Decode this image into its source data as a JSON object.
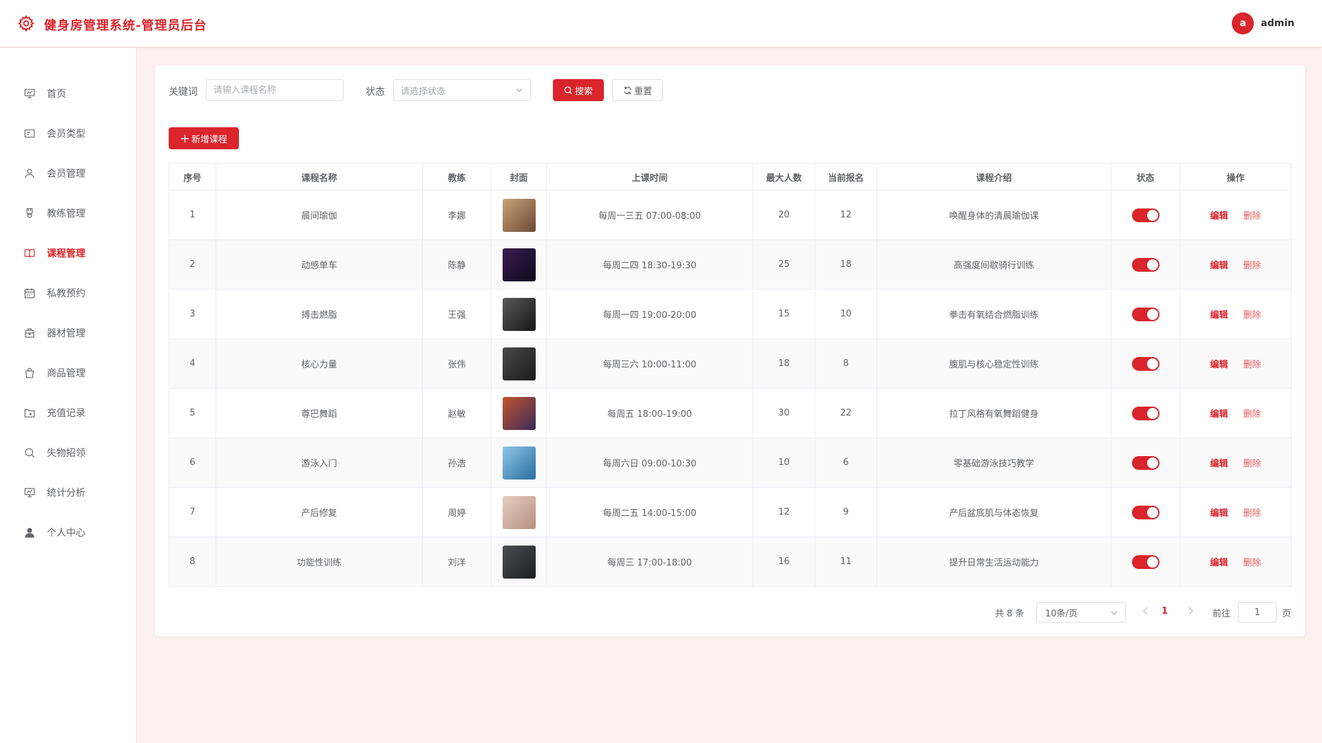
{
  "app": {
    "title": "健身房管理系统-管理员后台",
    "user_initial": "a",
    "username": "admin"
  },
  "sidebar": {
    "items": [
      {
        "label": "首页",
        "icon": "dashboard-icon"
      },
      {
        "label": "会员类型",
        "icon": "card-icon"
      },
      {
        "label": "会员管理",
        "icon": "user-icon"
      },
      {
        "label": "教练管理",
        "icon": "medal-icon"
      },
      {
        "label": "课程管理",
        "icon": "book-icon",
        "active": true
      },
      {
        "label": "私教预约",
        "icon": "calendar-icon"
      },
      {
        "label": "器材管理",
        "icon": "box-icon"
      },
      {
        "label": "商品管理",
        "icon": "bag-icon"
      },
      {
        "label": "充值记录",
        "icon": "folder-icon"
      },
      {
        "label": "失物招领",
        "icon": "search-icon"
      },
      {
        "label": "统计分析",
        "icon": "chart-icon"
      },
      {
        "label": "个人中心",
        "icon": "person-icon"
      }
    ]
  },
  "filters": {
    "keyword_label": "关键词",
    "keyword_placeholder": "请输入课程名称",
    "status_label": "状态",
    "status_placeholder": "请选择状态",
    "search_label": "搜索",
    "reset_label": "重置"
  },
  "add_button": "新增课程",
  "table": {
    "headers": [
      "序号",
      "课程名称",
      "教练",
      "封面",
      "上课时间",
      "最大人数",
      "当前报名",
      "课程介绍",
      "状态",
      "操作"
    ],
    "edit_label": "编辑",
    "delete_label": "删除",
    "rows": [
      {
        "no": "1",
        "name": "晨间瑜伽",
        "coach": "李娜",
        "time": "每周一三五 07:00-08:00",
        "max": "20",
        "current": "12",
        "desc": "唤醒身体的清晨瑜伽课",
        "enabled": true,
        "cover": [
          "#c9a27a",
          "#6b4a33"
        ]
      },
      {
        "no": "2",
        "name": "动感单车",
        "coach": "陈静",
        "time": "每周二四 18:30-19:30",
        "max": "25",
        "current": "18",
        "desc": "高强度间歇骑行训练",
        "enabled": true,
        "cover": [
          "#3a1d4f",
          "#0d0a1c"
        ]
      },
      {
        "no": "3",
        "name": "搏击燃脂",
        "coach": "王强",
        "time": "每周一四 19:00-20:00",
        "max": "15",
        "current": "10",
        "desc": "拳击有氧结合燃脂训练",
        "enabled": true,
        "cover": [
          "#5a5a5a",
          "#151515"
        ]
      },
      {
        "no": "4",
        "name": "核心力量",
        "coach": "张伟",
        "time": "每周三六 10:00-11:00",
        "max": "18",
        "current": "8",
        "desc": "腹肌与核心稳定性训练",
        "enabled": true,
        "cover": [
          "#4a4a4a",
          "#1a1a1a"
        ]
      },
      {
        "no": "5",
        "name": "尊巴舞蹈",
        "coach": "赵敏",
        "time": "每周五 18:00-19:00",
        "max": "30",
        "current": "22",
        "desc": "拉丁风格有氧舞蹈健身",
        "enabled": true,
        "cover": [
          "#c2552e",
          "#3a2a5a"
        ]
      },
      {
        "no": "6",
        "name": "游泳入门",
        "coach": "孙浩",
        "time": "每周六日 09:00-10:30",
        "max": "10",
        "current": "6",
        "desc": "零基础游泳技巧教学",
        "enabled": true,
        "cover": [
          "#8fc7e8",
          "#2a6d9e"
        ]
      },
      {
        "no": "7",
        "name": "产后修复",
        "coach": "周婷",
        "time": "每周二五 14:00-15:00",
        "max": "12",
        "current": "9",
        "desc": "产后盆底肌与体态恢复",
        "enabled": true,
        "cover": [
          "#e8cfc2",
          "#b58f80"
        ]
      },
      {
        "no": "8",
        "name": "功能性训练",
        "coach": "刘洋",
        "time": "每周三 17:00-18:00",
        "max": "16",
        "current": "11",
        "desc": "提升日常生活运动能力",
        "enabled": true,
        "cover": [
          "#4c4f52",
          "#1c1e20"
        ]
      }
    ]
  },
  "pagination": {
    "total_text": "共 8 条",
    "page_size": "10条/页",
    "current_page": "1",
    "goto_label": "前往",
    "goto_value": "1",
    "page_suffix": "页"
  },
  "colors": {
    "accent": "#d9252b",
    "background": "#fdf0f0"
  }
}
